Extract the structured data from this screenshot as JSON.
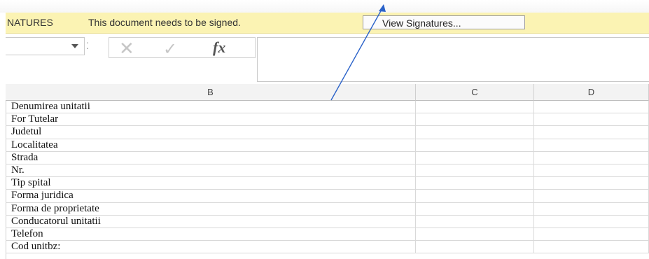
{
  "message_bar": {
    "label": "NATURES",
    "text": "This document needs to be signed.",
    "button": "View Signatures..."
  },
  "formula_bar": {
    "fx": "fx",
    "value": ""
  },
  "columns": [
    "B",
    "C",
    "D"
  ],
  "rows": [
    "Denumirea unitatii",
    "For Tutelar",
    "Judetul",
    "Localitatea",
    "Strada",
    "Nr.",
    "Tip spital",
    "Forma juridica",
    "Forma de proprietate",
    "Conducatorul unitatii",
    "Telefon",
    "Cod unitbz:"
  ],
  "colors": {
    "message_bar_bg": "#fbf3b3",
    "annotation_arrow": "#2a62c9"
  }
}
